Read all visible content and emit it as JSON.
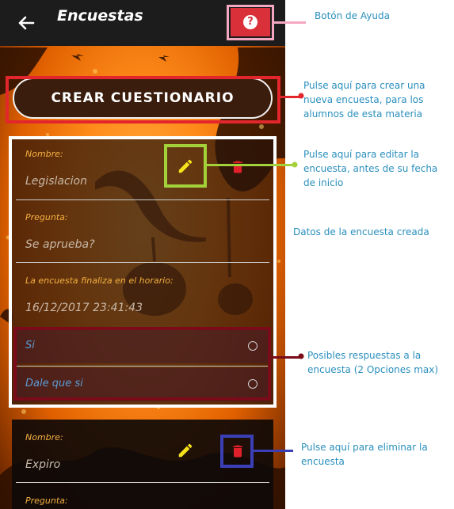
{
  "appbar": {
    "title": "Encuestas",
    "help_symbol": "?",
    "back_icon": "arrow-left-icon"
  },
  "create_button": {
    "label": "CREAR CUESTIONARIO"
  },
  "survey_cards": [
    {
      "name_label": "Nombre:",
      "name_value": "Legislacion",
      "question_label": "Pregunta:",
      "question_value": "Se aprueba?",
      "end_label": "La encuesta finaliza en el horario:",
      "end_value": "16/12/2017 23:41:43",
      "answers": [
        "Si",
        "Dale que si"
      ]
    },
    {
      "name_label": "Nombre:",
      "name_value": "Expiro",
      "question_label": "Pregunta:"
    }
  ],
  "annotations": {
    "help": "Botón de Ayuda",
    "create": "Pulse aquí para crear una nueva encuesta, para los alumnos de esta materia",
    "edit": "Pulse aquí para editar la encuesta, antes de su fecha de inicio",
    "data": "Datos de la encuesta creada",
    "answers": "Posibles respuestas a la encuesta (2 Opciones max)",
    "delete": "Pulse aquí para eliminar la encuesta"
  },
  "colors": {
    "appbar": "#1c1c1c",
    "help_button": "#d9303a",
    "help_callout": "#f4a7c1",
    "create_callout": "#e3262b",
    "edit_callout": "#a3d13a",
    "delete_callout": "#3b3fb6",
    "answers_callout": "#7b0b18",
    "edit_icon": "#f7e31b",
    "delete_icon": "#e0202a",
    "annotation_text": "#2a8fbd",
    "label_text": "#f5b041",
    "answer_text": "#5b9bd5"
  }
}
